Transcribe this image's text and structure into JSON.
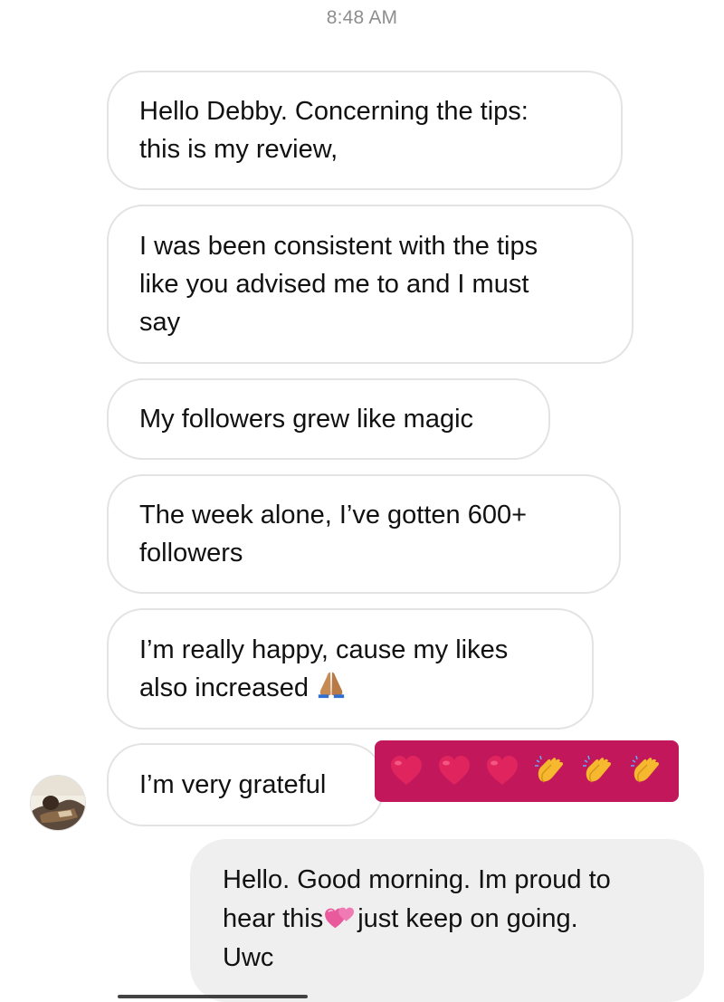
{
  "conversation": {
    "timestamp": "8:48 AM",
    "incoming_messages": [
      {
        "lines": [
          "Hello Debby. Concerning the tips:",
          "this is my review,"
        ]
      },
      {
        "lines": [
          "I was been consistent with the tips",
          "like you advised me to and I must",
          "say"
        ]
      },
      {
        "lines": [
          "My followers grew like magic"
        ]
      },
      {
        "lines": [
          "The week alone, I’ve gotten 600+",
          "followers"
        ]
      },
      {
        "lines": [
          "I’m really happy, cause my likes",
          "also increased"
        ],
        "trailing_emoji": "folded-hands-emoji"
      },
      {
        "lines": [
          "I’m very grateful"
        ]
      }
    ],
    "reaction_strip": {
      "background_color": "#c2185b",
      "emojis": [
        "red-heart-emoji",
        "red-heart-emoji",
        "red-heart-emoji",
        "clapping-hands-emoji",
        "clapping-hands-emoji",
        "clapping-hands-emoji"
      ]
    },
    "outgoing_message": {
      "line1": "Hello. Good morning. Im proud to",
      "line2_before": "hear this",
      "line2_emoji": "two-hearts-emoji",
      "line2_after": "just keep on going.",
      "line3": "Uwc"
    }
  },
  "colors": {
    "incoming_bubble_border": "#e3e3e3",
    "outgoing_bubble_bg": "#efefef",
    "timestamp_text": "#8e8e8e"
  }
}
